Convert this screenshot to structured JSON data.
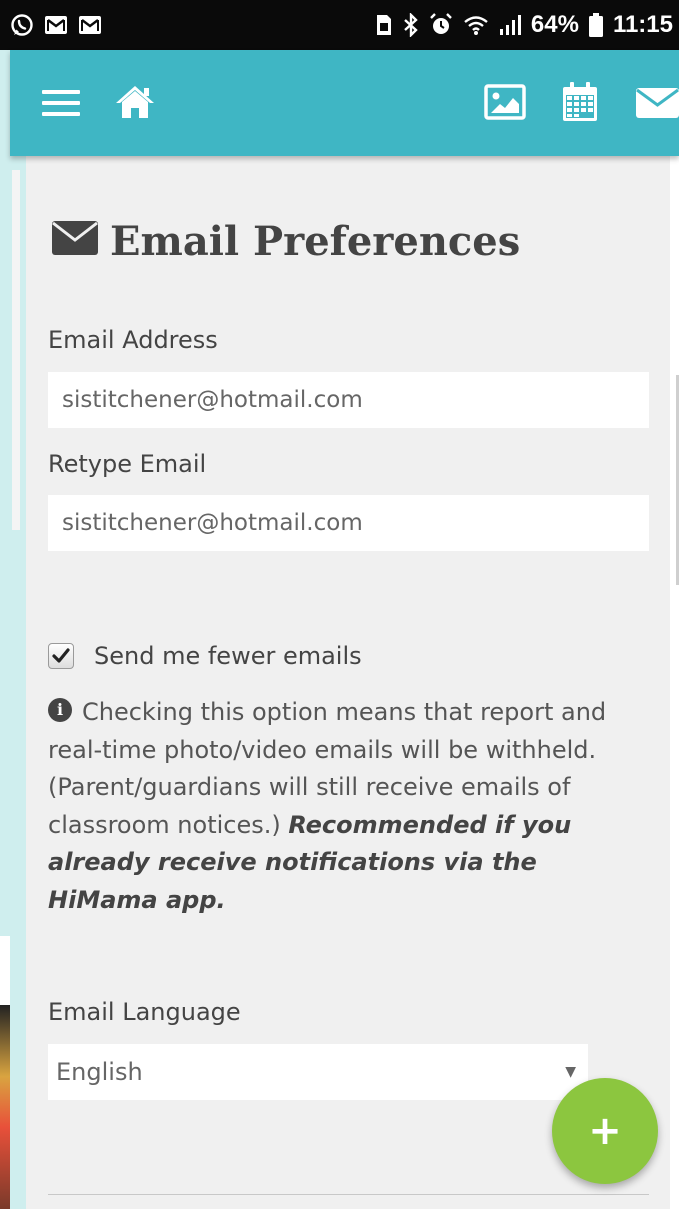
{
  "status_bar": {
    "battery_percent": "64%",
    "time": "11:15",
    "left_icons": [
      "whatsapp-icon",
      "gmail-icon",
      "gmail-icon"
    ],
    "right_icons": [
      "sim-icon",
      "bluetooth-icon",
      "alarm-icon",
      "wifi-icon",
      "signal-icon",
      "battery-icon"
    ]
  },
  "app_bar": {
    "color": "#3fb6c4",
    "left_icons": [
      "menu-icon",
      "home-icon"
    ],
    "right_icons": [
      "image-icon",
      "calendar-icon",
      "envelope-icon"
    ]
  },
  "page": {
    "title": "Email Preferences",
    "title_icon": "envelope-icon"
  },
  "form": {
    "email_label": "Email Address",
    "email_value": "sistitchener@hotmail.com",
    "retype_label": "Retype Email",
    "retype_value": "sistitchener@hotmail.com",
    "fewer_emails_label": "Send me fewer emails",
    "fewer_emails_checked": true,
    "info_text": "Checking this option means that report and real-time photo/video emails will be withheld. (Parent/guardians will still receive emails of classroom notices.) ",
    "info_emphasis": "Recommended if you already receive notifications via the HiMama app.",
    "language_label": "Email Language",
    "language_selected": "English"
  },
  "fab": {
    "label": "+",
    "color": "#8cc63f"
  }
}
